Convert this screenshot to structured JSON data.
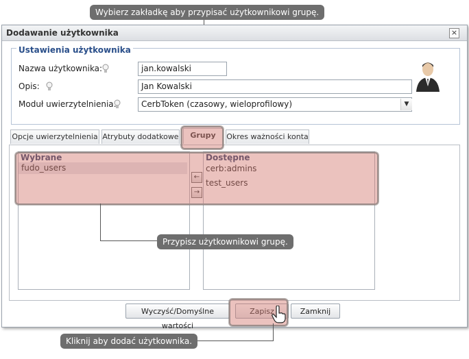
{
  "callouts": {
    "top": "Wybierz zakładkę aby przypisać użytkownikowi grupę.",
    "middle": "Przypisz użytkownikowi grupę.",
    "bottom": "Kliknij aby dodać użytkownika."
  },
  "dialog": {
    "title": "Dodawanie użytkownika",
    "close_glyph": "×"
  },
  "settings": {
    "legend": "Ustawienia użytkownika",
    "username_label": "Nazwa użytkownika:",
    "username_value": "jan.kowalski",
    "description_label": "Opis:",
    "description_value": "Jan Kowalski",
    "auth_label": "Moduł uwierzytelnienia:",
    "auth_value": "CerbToken (czasowy, wieloprofilowy)"
  },
  "tabs": [
    {
      "label": "Opcje uwierzytelnienia"
    },
    {
      "label": "Atrybuty dodatkowe"
    },
    {
      "label": "Grupy"
    },
    {
      "label": "Okres ważności konta"
    }
  ],
  "groups": {
    "selected_header": "Wybrane",
    "selected_items": [
      "fudo_users"
    ],
    "available_header": "Dostępne",
    "available_items": [
      "cerb:admins",
      "test_users"
    ],
    "move_left_glyph": "←",
    "move_right_glyph": "→"
  },
  "buttons": {
    "reset": "Wyczyść/Domyślne wartości",
    "save": "Zapisz",
    "close": "Zamknij"
  },
  "colors": {
    "highlight": "#d2786e",
    "callout_bg": "#6e6e6e",
    "legend_text": "#2a4f8a"
  }
}
